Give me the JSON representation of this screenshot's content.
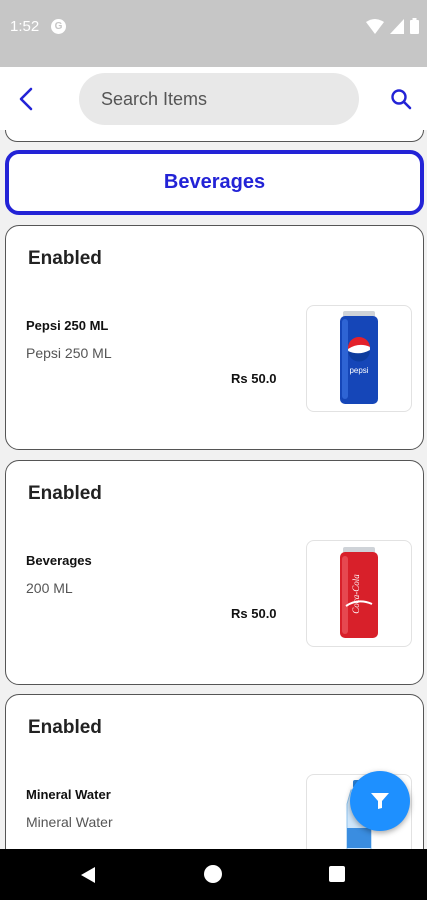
{
  "status_bar": {
    "time": "1:52",
    "app_badge": "G"
  },
  "header": {
    "search_placeholder": "Search Items"
  },
  "category": {
    "label": "Beverages"
  },
  "items": [
    {
      "status": "Enabled",
      "name": "Pepsi 250 ML",
      "description": "Pepsi 250 ML",
      "price": "Rs 50.0",
      "image": "pepsi-can"
    },
    {
      "status": "Enabled",
      "name": "Beverages",
      "description": "200 ML",
      "price": "Rs 50.0",
      "image": "coca-cola-can"
    },
    {
      "status": "Enabled",
      "name": "Mineral Water",
      "description": "Mineral Water",
      "price": "",
      "image": "water-bottle"
    }
  ],
  "colors": {
    "accent": "#2323d6",
    "fab": "#1e90ff",
    "status_bar": "#c6c6c6"
  },
  "icons": [
    "back-arrow-icon",
    "search-icon",
    "filter-icon",
    "wifi-icon",
    "signal-icon",
    "battery-icon"
  ]
}
